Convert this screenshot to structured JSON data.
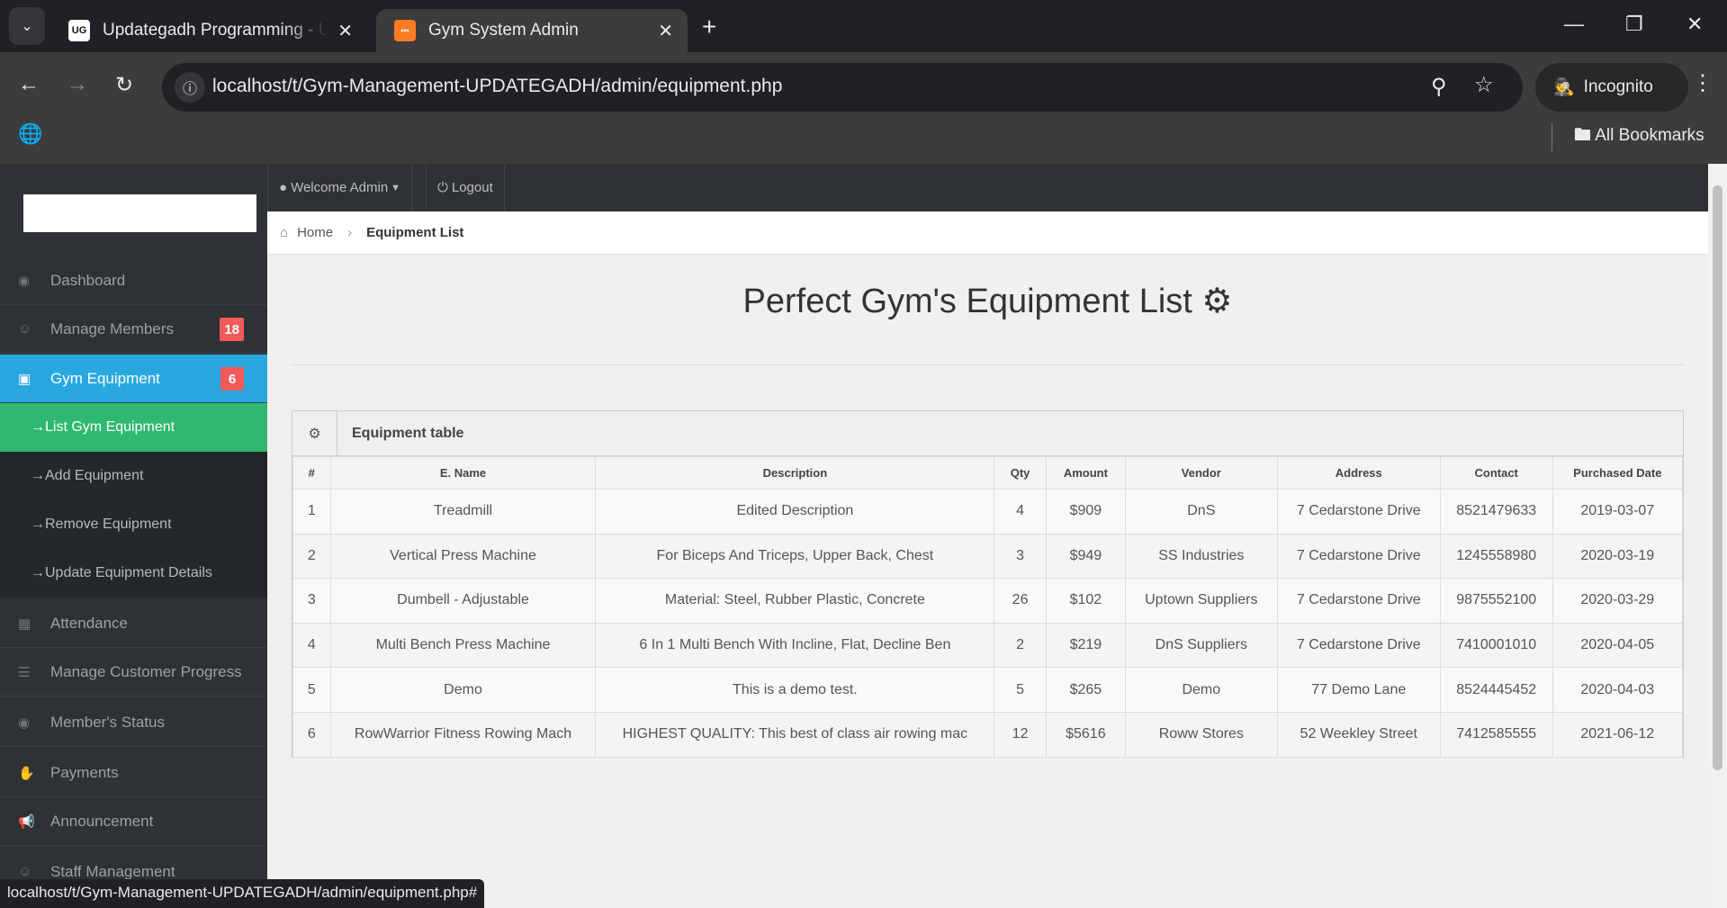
{
  "browser": {
    "tabs": [
      {
        "title": "Updategadh Programming - Up",
        "favicon": "UG"
      },
      {
        "title": "Gym System Admin",
        "favicon": "XAMPP"
      }
    ],
    "url": "localhost/t/Gym-Management-UPDATEGADH/admin/equipment.php",
    "incognito_label": "Incognito",
    "bookmarks_label": "All Bookmarks",
    "status_url": "localhost/t/Gym-Management-UPDATEGADH/admin/equipment.php#"
  },
  "topbar": {
    "welcome": "Welcome Admin",
    "logout": "Logout"
  },
  "sidebar": {
    "items": [
      {
        "label": "Dashboard",
        "icon": "dashboard-icon"
      },
      {
        "label": "Manage Members",
        "icon": "users-icon",
        "badge": "18"
      },
      {
        "label": "Gym Equipment",
        "icon": "dumbbell-icon",
        "badge": "6"
      },
      {
        "label": "Attendance",
        "icon": "calendar-icon"
      },
      {
        "label": "Manage Customer Progress",
        "icon": "list-icon"
      },
      {
        "label": "Member's Status",
        "icon": "eye-icon"
      },
      {
        "label": "Payments",
        "icon": "hand-icon"
      },
      {
        "label": "Announcement",
        "icon": "megaphone-icon"
      },
      {
        "label": "Staff Management",
        "icon": "staff-icon"
      }
    ],
    "sub_items": [
      {
        "label": "List Gym Equipment"
      },
      {
        "label": "Add Equipment"
      },
      {
        "label": "Remove Equipment"
      },
      {
        "label": "Update Equipment Details"
      }
    ]
  },
  "breadcrumb": {
    "home": "Home",
    "current": "Equipment List"
  },
  "page": {
    "title": "Perfect Gym's Equipment List"
  },
  "table": {
    "title": "Equipment table",
    "columns": [
      "#",
      "E. Name",
      "Description",
      "Qty",
      "Amount",
      "Vendor",
      "Address",
      "Contact",
      "Purchased Date"
    ],
    "rows": [
      [
        "1",
        "Treadmill",
        "Edited Description",
        "4",
        "$909",
        "DnS",
        "7 Cedarstone Drive",
        "8521479633",
        "2019-03-07"
      ],
      [
        "2",
        "Vertical Press Machine",
        "For Biceps And Triceps, Upper Back, Chest",
        "3",
        "$949",
        "SS Industries",
        "7 Cedarstone Drive",
        "1245558980",
        "2020-03-19"
      ],
      [
        "3",
        "Dumbell - Adjustable",
        "Material: Steel, Rubber Plastic, Concrete",
        "26",
        "$102",
        "Uptown Suppliers",
        "7 Cedarstone Drive",
        "9875552100",
        "2020-03-29"
      ],
      [
        "4",
        "Multi Bench Press Machine",
        "6 In 1 Multi Bench With Incline, Flat, Decline Ben",
        "2",
        "$219",
        "DnS Suppliers",
        "7 Cedarstone Drive",
        "7410001010",
        "2020-04-05"
      ],
      [
        "5",
        "Demo",
        "This is a demo test.",
        "5",
        "$265",
        "Demo",
        "77 Demo Lane",
        "8524445452",
        "2020-04-03"
      ],
      [
        "6",
        "RowWarrior Fitness Rowing Mach",
        "HIGHEST QUALITY: This best of class air rowing mac",
        "12",
        "$5616",
        "Roww Stores",
        "52 Weekley Street",
        "7412585555",
        "2021-06-12"
      ]
    ]
  }
}
